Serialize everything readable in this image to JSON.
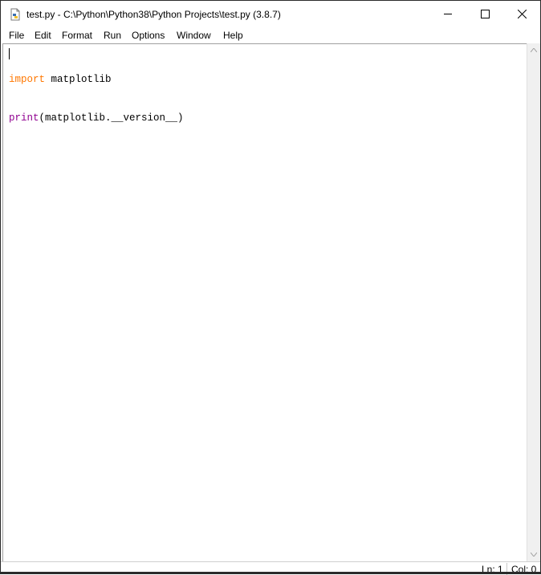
{
  "window": {
    "title": "test.py - C:\\Python\\Python38\\Python Projects\\test.py (3.8.7)",
    "icon": "python-file-icon"
  },
  "menu": {
    "file": "File",
    "edit": "Edit",
    "format": "Format",
    "run": "Run",
    "options": "Options",
    "window": "Window",
    "help": "Help"
  },
  "editor": {
    "lines": [
      {
        "keyword": "import",
        "keyword_color": "#ff7700",
        "rest": " matplotlib"
      },
      {
        "keyword": "print",
        "keyword_color": "#900090",
        "rest": "(matplotlib.__version__)"
      }
    ]
  },
  "status": {
    "line": "Ln: 1",
    "column": "Col: 0"
  },
  "colors": {
    "keyword": "#ff7700",
    "builtin": "#900090",
    "background": "#ffffff"
  }
}
